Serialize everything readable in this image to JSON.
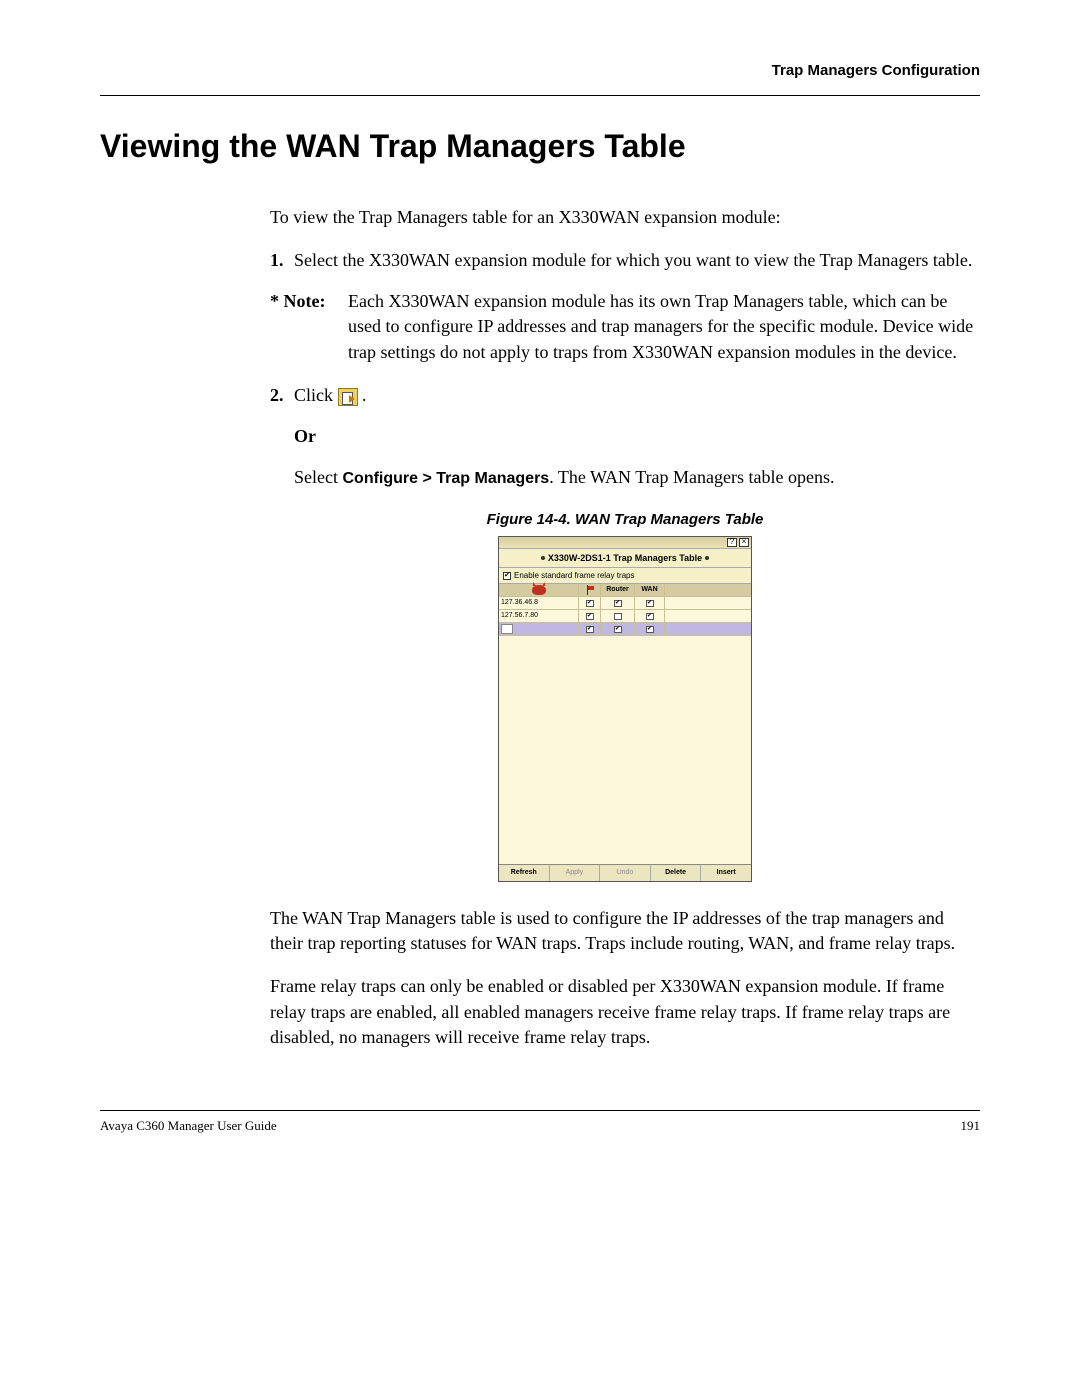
{
  "header": {
    "section": "Trap Managers Configuration"
  },
  "title": "Viewing the WAN Trap Managers Table",
  "intro": "To view the Trap Managers table for an X330WAN expansion module:",
  "steps": {
    "s1_num": "1.",
    "s1_text": "Select the X330WAN expansion module for which you want to view the Trap Managers table.",
    "note_label": "* Note:",
    "note_text": "Each X330WAN expansion module has its own Trap Managers table, which can be used to configure IP addresses and trap managers for the specific module. Device wide trap settings do not apply to traps from X330WAN expansion modules in the device.",
    "s2_num": "2.",
    "s2_pre": "Click ",
    "s2_post": " .",
    "or": "Or",
    "select_pre": "Select ",
    "select_bold": "Configure > Trap Managers",
    "select_post": ". The WAN Trap Managers table opens."
  },
  "figure": {
    "caption": "Figure 14-4.  WAN Trap Managers Table"
  },
  "window": {
    "title": "X330W-2DS1-1 Trap Managers Table",
    "fr_label": "Enable standard frame relay traps",
    "cols": {
      "c1": "",
      "c2": "",
      "c3": "Router",
      "c4": "WAN"
    },
    "rows": [
      {
        "ip": "127.36.46.8",
        "c2": true,
        "c3": true,
        "c4": true
      },
      {
        "ip": "127.56.7.80",
        "c2": true,
        "c3": false,
        "c4": true
      },
      {
        "ip": "",
        "c2": true,
        "c3": true,
        "c4": true,
        "new": true
      }
    ],
    "buttons": {
      "refresh": "Refresh",
      "apply": "Apply",
      "undo": "Undo",
      "delete": "Delete",
      "insert": "Insert"
    },
    "close": "×",
    "help": "?"
  },
  "para1": "The WAN Trap Managers table is used to configure the IP addresses of the trap managers and their trap reporting statuses for WAN traps. Traps include routing, WAN, and frame relay traps.",
  "para2": "Frame relay traps can only be enabled or disabled per X330WAN expansion module. If frame relay traps are enabled, all enabled managers receive frame relay traps. If frame relay traps are disabled, no managers will receive frame relay traps.",
  "footer": {
    "left": "Avaya C360 Manager User Guide",
    "right": "191"
  }
}
